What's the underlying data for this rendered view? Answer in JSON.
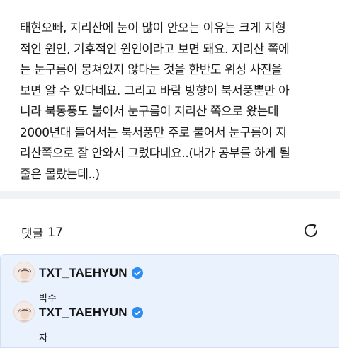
{
  "post": {
    "body": "태현오빠, 지리산에 눈이 많이 안오는 이유는 크게 지형\n적인 원인, 기후적인 원인이라고 보면 돼요. 지리산 쪽에\n는 눈구름이 뭉쳐있지 않다는 것을 한반도 위성 사진을\n보면 알 수 있다네요. 그리고 바람 방향이 북서풍뿐만 아\n니라 북동풍도 불어서 눈구름이 지리산 쪽으로 왔는데\n2000년대 들어서는 북서풍만 주로 불어서 눈구름이 지\n리산쪽으로 잘 안와서 그렀다네요..(내가 공부를 하게 될\n줄은 몰랐는데..)"
  },
  "comments": {
    "label": "댓글",
    "count": "17",
    "refresh_icon": "refresh-icon",
    "items": [
      {
        "author": "TXT_TAEHYUN",
        "verified_icon": "verified-badge-icon",
        "text": "박수"
      },
      {
        "author": "TXT_TAEHYUN",
        "verified_icon": "verified-badge-icon",
        "text": "자"
      }
    ]
  },
  "colors": {
    "accent": "#2d8cf0",
    "highlight_bg": "#eaf3fd",
    "divider_bg": "#f1f2f4"
  }
}
